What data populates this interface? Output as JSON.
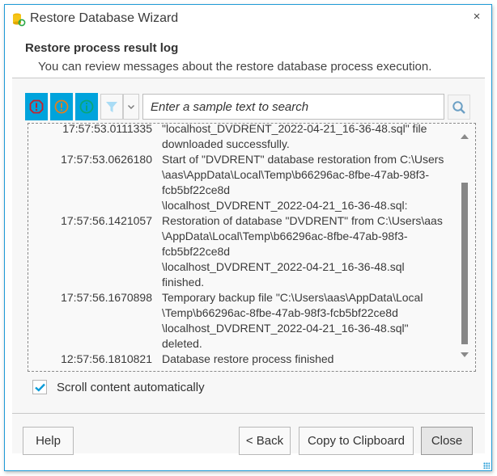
{
  "window": {
    "title": "Restore Database Wizard",
    "close_glyph": "×"
  },
  "header": {
    "heading": "Restore process result log",
    "subheading": "You can review messages about the restore database process execution."
  },
  "toolbar": {
    "buttons": [
      {
        "name": "show-errors",
        "icon": "error-icon",
        "color": "#c8202a"
      },
      {
        "name": "show-warnings",
        "icon": "warning-icon",
        "color": "#e0801e"
      },
      {
        "name": "show-info",
        "icon": "info-icon",
        "color": "#0aa57a"
      }
    ],
    "filter_icon": "filter-icon",
    "search": {
      "value": "",
      "placeholder": "Enter a sample text to search"
    },
    "accent": "#00a3dc"
  },
  "log": {
    "entries": [
      {
        "time": "17:57:53.0111335",
        "lines": [
          "\"localhost_DVDRENT_2022-04-21_16-36-48.sql\" file",
          "downloaded successfully."
        ]
      },
      {
        "time": "17:57:53.0626180",
        "lines": [
          "Start of \"DVDRENT\" database restoration from C:\\Users",
          "\\aas\\AppData\\Local\\Temp\\b66296ac-8fbe-47ab-98f3-",
          "fcb5bf22ce8d",
          "\\localhost_DVDRENT_2022-04-21_16-36-48.sql:"
        ]
      },
      {
        "time": "17:57:56.1421057",
        "lines": [
          "Restoration of database \"DVDRENT\" from C:\\Users\\aas",
          "\\AppData\\Local\\Temp\\b66296ac-8fbe-47ab-98f3-",
          "fcb5bf22ce8d",
          "\\localhost_DVDRENT_2022-04-21_16-36-48.sql",
          "finished."
        ]
      },
      {
        "time": "17:57:56.1670898",
        "lines": [
          "Temporary backup file \"C:\\Users\\aas\\AppData\\Local",
          "\\Temp\\b66296ac-8fbe-47ab-98f3-fcb5bf22ce8d",
          "\\localhost_DVDRENT_2022-04-21_16-36-48.sql\"",
          "deleted."
        ]
      },
      {
        "time": "12:57:56.1810821",
        "lines": [
          "Database restore process finished"
        ]
      }
    ],
    "scroll_position_fraction": 0.75
  },
  "options": {
    "auto_scroll_label": "Scroll content automatically",
    "auto_scroll_checked": true
  },
  "footer": {
    "help_label": "Help",
    "back_label": "< Back",
    "copy_label": "Copy to Clipboard",
    "close_label": "Close"
  }
}
